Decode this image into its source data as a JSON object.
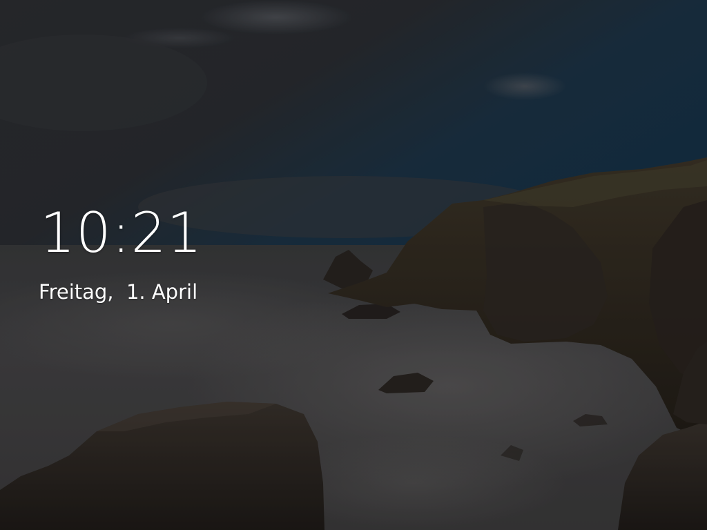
{
  "lockscreen": {
    "time": "10:21",
    "date": "Freitag,  1. April"
  }
}
